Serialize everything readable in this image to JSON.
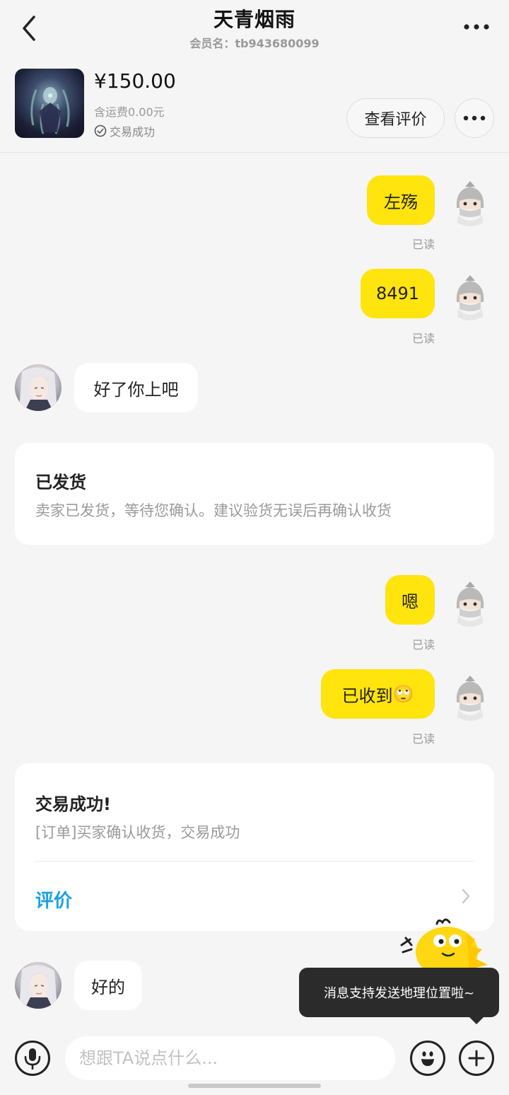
{
  "header": {
    "title": "天青烟雨",
    "member_label": "会员名：tb943680099"
  },
  "product": {
    "price": "¥150.00",
    "shipping": "含运费0.00元",
    "status": "交易成功",
    "review_button": "查看评价"
  },
  "messages": [
    {
      "from": "me",
      "text": "左殇",
      "read": "已读"
    },
    {
      "from": "me",
      "text": "8491",
      "read": "已读"
    },
    {
      "from": "them",
      "text": "好了你上吧"
    },
    {
      "from": "me",
      "text": "嗯",
      "read": "已读"
    },
    {
      "from": "me",
      "text": "已收到",
      "emoji": "🙄",
      "read": "已读"
    },
    {
      "from": "them",
      "text": "好的"
    }
  ],
  "shipped_card": {
    "title": "已发货",
    "text": "卖家已发货，等待您确认。建议验货无误后再确认收货"
  },
  "success_card": {
    "title": "交易成功!",
    "text": "[订单]买家确认收货，交易成功",
    "action": "评价"
  },
  "tooltip": "消息支持发送地理位置啦~",
  "input": {
    "placeholder": "想跟TA说点什么..."
  },
  "colors": {
    "my_bubble": "#ffe40d",
    "link": "#1aa0e6",
    "tooltip_bg": "#2b2b2b"
  }
}
